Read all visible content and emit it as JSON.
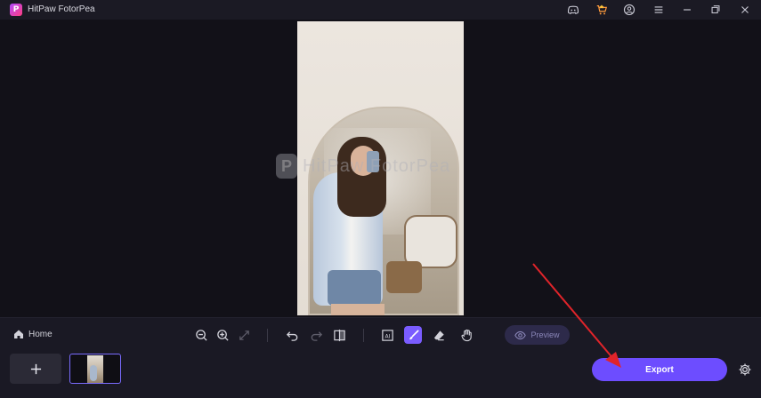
{
  "app": {
    "title": "HitPaw FotorPea",
    "logo_letter": "P"
  },
  "titlebar": {
    "icons": [
      "discord-icon",
      "shop-icon",
      "account-icon",
      "menu-icon",
      "minimize-icon",
      "restore-icon",
      "close-icon"
    ]
  },
  "canvas": {
    "watermark_text": "HitPaw FotorPea",
    "watermark_letter": "P"
  },
  "toolbar": {
    "home_label": "Home",
    "preview_label": "Preview",
    "active_tool": "brush"
  },
  "bottom": {
    "export_label": "Export",
    "add_label": "+"
  },
  "colors": {
    "accent": "#6d4dff",
    "active_tool": "#7a5cff",
    "annotation_arrow": "#e0242a"
  }
}
